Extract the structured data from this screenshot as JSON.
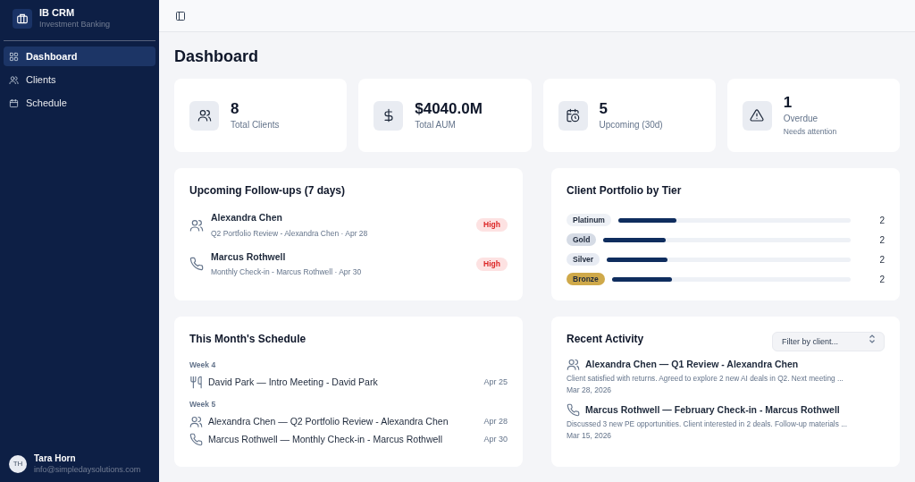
{
  "brand": {
    "title": "IB CRM",
    "subtitle": "Investment Banking"
  },
  "nav": [
    {
      "label": "Dashboard",
      "kind": "grid",
      "selected": true
    },
    {
      "label": "Clients",
      "kind": "users",
      "selected": false
    },
    {
      "label": "Schedule",
      "kind": "calendar",
      "selected": false
    }
  ],
  "user": {
    "initials": "TH",
    "name": "Tara Horn",
    "email": "info@simpledaysolutions.com"
  },
  "page_title": "Dashboard",
  "stats": [
    {
      "kind": "users",
      "value": "8",
      "label": "Total Clients"
    },
    {
      "kind": "dollar",
      "value": "$4040.0M",
      "label": "Total AUM"
    },
    {
      "kind": "calendar-clock",
      "value": "5",
      "label": "Upcoming (30d)"
    },
    {
      "kind": "alert",
      "value": "1",
      "label": "Overdue",
      "note": "Needs attention"
    }
  ],
  "followups": {
    "title": "Upcoming Follow-ups (7 days)",
    "items": [
      {
        "kind": "users",
        "name": "Alexandra Chen",
        "detail": "Q2 Portfolio Review - Alexandra Chen · Apr 28",
        "priority": "High"
      },
      {
        "kind": "phone",
        "name": "Marcus Rothwell",
        "detail": "Monthly Check-in - Marcus Rothwell · Apr 30",
        "priority": "High"
      }
    ]
  },
  "tiers": {
    "title": "Client Portfolio by Tier",
    "items": [
      {
        "label": "Platinum",
        "color": "#eef1f6",
        "level": 0.25,
        "count": "2"
      },
      {
        "label": "Gold",
        "color": "#d5dbe5",
        "level": 0.25,
        "count": "2"
      },
      {
        "label": "Silver",
        "color": "#e7ebf3",
        "level": 0.25,
        "count": "2"
      },
      {
        "label": "Bronze",
        "color": "#cfa94a",
        "level": 0.25,
        "count": "2"
      }
    ]
  },
  "schedule": {
    "title": "This Month's Schedule",
    "weeks": [
      {
        "label": "Week 4",
        "items": [
          {
            "kind": "utensils",
            "text": "David Park — Intro Meeting - David Park",
            "date": "Apr 25"
          }
        ]
      },
      {
        "label": "Week 5",
        "items": [
          {
            "kind": "users",
            "text": "Alexandra Chen — Q2 Portfolio Review - Alexandra Chen",
            "date": "Apr 28"
          },
          {
            "kind": "phone",
            "text": "Marcus Rothwell — Monthly Check-in - Marcus Rothwell",
            "date": "Apr 30"
          }
        ]
      }
    ]
  },
  "activity": {
    "title": "Recent Activity",
    "filter": {
      "placeholder": "Filter by client..."
    },
    "items": [
      {
        "kind": "users",
        "title": "Alexandra Chen — Q1 Review - Alexandra Chen",
        "body": "Client satisfied with returns. Agreed to explore 2 new AI deals in Q2. Next meeting ...",
        "date": "Mar 28, 2026"
      },
      {
        "kind": "phone",
        "title": "Marcus Rothwell — February Check-in - Marcus Rothwell",
        "body": "Discussed 3 new PE opportunities. Client interested in 2 deals. Follow-up materials ...",
        "date": "Mar 15, 2026"
      }
    ]
  }
}
